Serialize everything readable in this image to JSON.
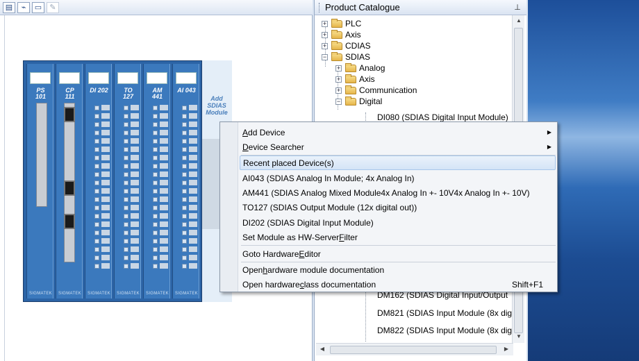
{
  "editor": {
    "toolbar_icons": [
      "new-page-icon",
      "chart-icon",
      "window-icon",
      "disabled-tool-icon"
    ],
    "modules": [
      {
        "name": "PS\n101"
      },
      {
        "name": "CP\n111"
      },
      {
        "name": "DI 202"
      },
      {
        "name": "TO\n127"
      },
      {
        "name": "AM\n441"
      },
      {
        "name": "AI 043"
      }
    ],
    "brand": "SIGMATEK",
    "add_module_text": "Add\nSDIAS\nModule"
  },
  "catalogue": {
    "title": "Product Catalogue",
    "pin_icon": "pin-icon",
    "tree": [
      {
        "label": "PLC",
        "expander": "+"
      },
      {
        "label": "Axis",
        "expander": "+"
      },
      {
        "label": "CDIAS",
        "expander": "+"
      },
      {
        "label": "SDIAS",
        "expander": "−"
      },
      {
        "label": "Analog",
        "expander": "+"
      },
      {
        "label": "Axis",
        "expander": "+"
      },
      {
        "label": "Communication",
        "expander": "+"
      },
      {
        "label": "Digital",
        "expander": "−"
      },
      {
        "label": "DI080 (SDIAS Digital Input Module)"
      },
      {
        "label": "DM162 (SDIAS Digital Input/Output"
      },
      {
        "label": "DM821 (SDIAS Input Module (8x dig"
      },
      {
        "label": "DM822 (SDIAS Input Module (8x dig"
      }
    ]
  },
  "context_menu": {
    "items": [
      {
        "pre": "",
        "ul": "A",
        "post": "dd Device",
        "submenu": "▶"
      },
      {
        "pre": "",
        "ul": "D",
        "post": "evice Searcher",
        "submenu": "▶"
      },
      {
        "pre": "Recent placed Device(s)",
        "ul": "",
        "post": ""
      },
      {
        "pre": "AI043 (SDIAS Analog In Module; 4x Analog In)",
        "ul": "",
        "post": ""
      },
      {
        "pre": "AM441 (SDIAS Analog Mixed Module4x Analog In +- 10V4x Analog In +- 10V)",
        "ul": "",
        "post": ""
      },
      {
        "pre": "TO127 (SDIAS Output Module (12x digital out))",
        "ul": "",
        "post": ""
      },
      {
        "pre": "DI202 (SDIAS Digital Input Module)",
        "ul": "",
        "post": ""
      },
      {
        "pre": "Set Module as HW-Server ",
        "ul": "F",
        "post": "ilter"
      },
      {
        "pre": "Goto Hardware ",
        "ul": "E",
        "post": "ditor"
      },
      {
        "pre": "Open ",
        "ul": "h",
        "post": "ardware module documentation"
      },
      {
        "pre": "Open hardware ",
        "ul": "c",
        "post": "lass documentation",
        "shortcut": "Shift+F1"
      }
    ]
  }
}
